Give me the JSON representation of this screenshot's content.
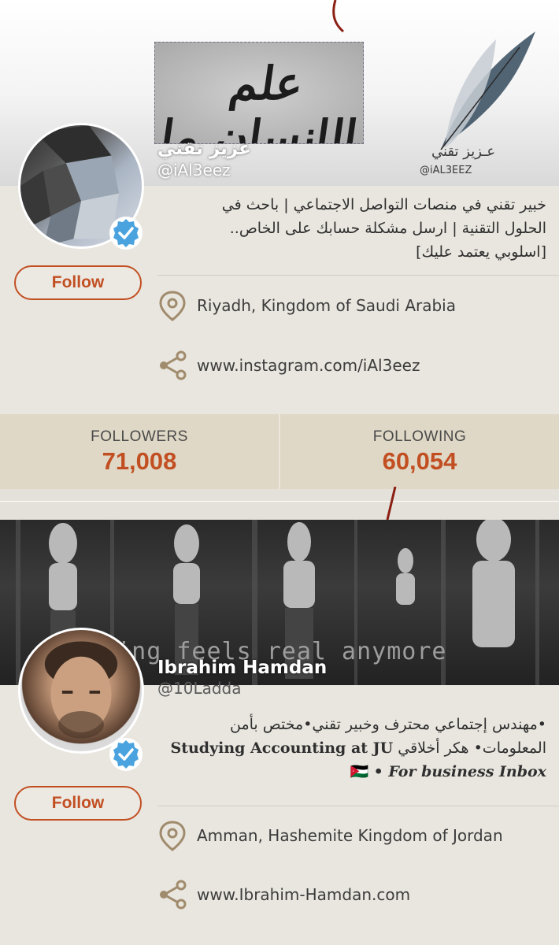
{
  "colors": {
    "accent": "#c24f22",
    "background": "#e9e6df",
    "stats_band": "#dfd8c6",
    "verified": "#4aa3df",
    "icon": "#a08b6d"
  },
  "profiles": [
    {
      "banner": {
        "calligraphy": "علم الإنسان ما لم يعلم",
        "watermark_ar": "عـزيز تقني",
        "watermark_en": "@iAL3EEZ"
      },
      "name": "عزيز تقني",
      "handle": "@iAl3eez",
      "follow_label": "Follow",
      "bio_lines": [
        "خبير تقني في منصات التواصل الاجتماعي | باحث في",
        "الحلول التقنية | ارسل مشكلة حسابك على الخاص..",
        "[اسلوبي يعتمد عليك]"
      ],
      "location": "Riyadh, Kingdom of Saudi Arabia",
      "website": "www.instagram.com/iAl3eez",
      "icons": {
        "location": "location-pin-icon",
        "website": "share-link-icon"
      },
      "followers_label": "FOLLOWERS",
      "followers": "71,008",
      "following_label": "FOLLOWING",
      "following": "60,054"
    },
    {
      "banner": {
        "text": "thing feels real anymore"
      },
      "name": "Ibrahim Hamdan",
      "handle": "@10Ladda",
      "follow_label": "Follow",
      "bio_line1": "•مهندس إجتماعي محترف وخبير تقني•مختص بأمن",
      "bio_line2_ar": "المعلومات• هكر أخلاقي",
      "bio_line2_en": "Studying Accounting at JU",
      "bio_line3_flag": "🇯🇴",
      "bio_line3_text": "• For business Inbox",
      "location": "Amman, Hashemite Kingdom of Jordan",
      "website": "www.Ibrahim-Hamdan.com",
      "icons": {
        "location": "location-pin-icon",
        "website": "share-link-icon"
      }
    }
  ]
}
